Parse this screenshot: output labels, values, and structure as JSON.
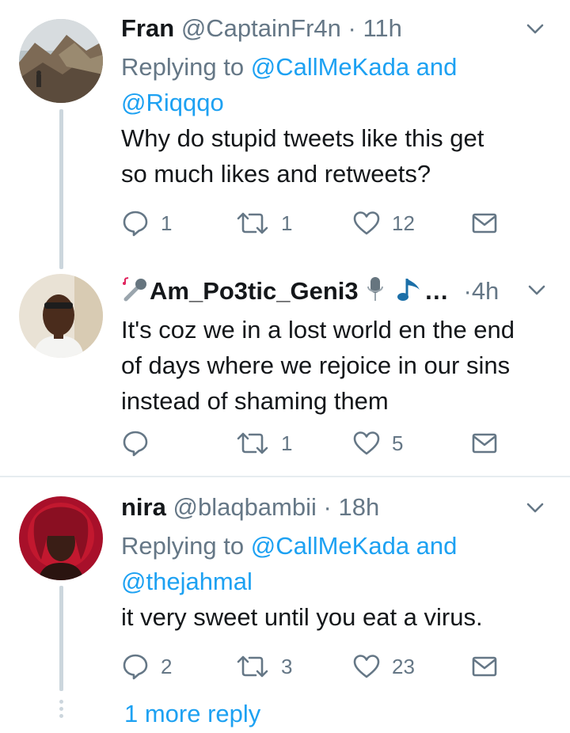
{
  "tweets": [
    {
      "name": "Fran",
      "handle": "@CaptainFr4n",
      "separator": "·",
      "time": "11h",
      "replying_prefix": "Replying to",
      "replying_mentions": "@CallMeKada and",
      "replying_mentions2": "@Riqqqo",
      "text_line1": "Why do stupid tweets like this get",
      "text_line2": "so much likes and retweets?",
      "replies": "1",
      "retweets": "1",
      "likes": "12"
    },
    {
      "name": "Am_Po3tic_Geni3",
      "ellipsis": "…",
      "separator": "·",
      "time": "4h",
      "text_line1": "It's coz we in a lost world en the end",
      "text_line2": "of days where we rejoice in our sins",
      "text_line3": "instead of shaming them",
      "replies": "",
      "retweets": "1",
      "likes": "5"
    },
    {
      "name": "nira",
      "handle": "@blaqbambii",
      "separator": "·",
      "time": "18h",
      "replying_prefix": "Replying to",
      "replying_mentions": "@CallMeKada and",
      "replying_mentions2": "@thejahmal",
      "text_line1": "it very sweet until you eat a virus.",
      "replies": "2",
      "retweets": "3",
      "likes": "23"
    }
  ],
  "more_reply": "1 more reply",
  "icons": [
    "reply-icon",
    "retweet-icon",
    "like-icon",
    "direct-message-icon",
    "chevron-down-icon",
    "microphone-emoji",
    "music-note-emoji"
  ],
  "colors": {
    "link": "#1da1f2",
    "muted": "#657786",
    "text": "#14171a",
    "thread": "#ccd6dd",
    "divider": "#e6ecf0"
  }
}
